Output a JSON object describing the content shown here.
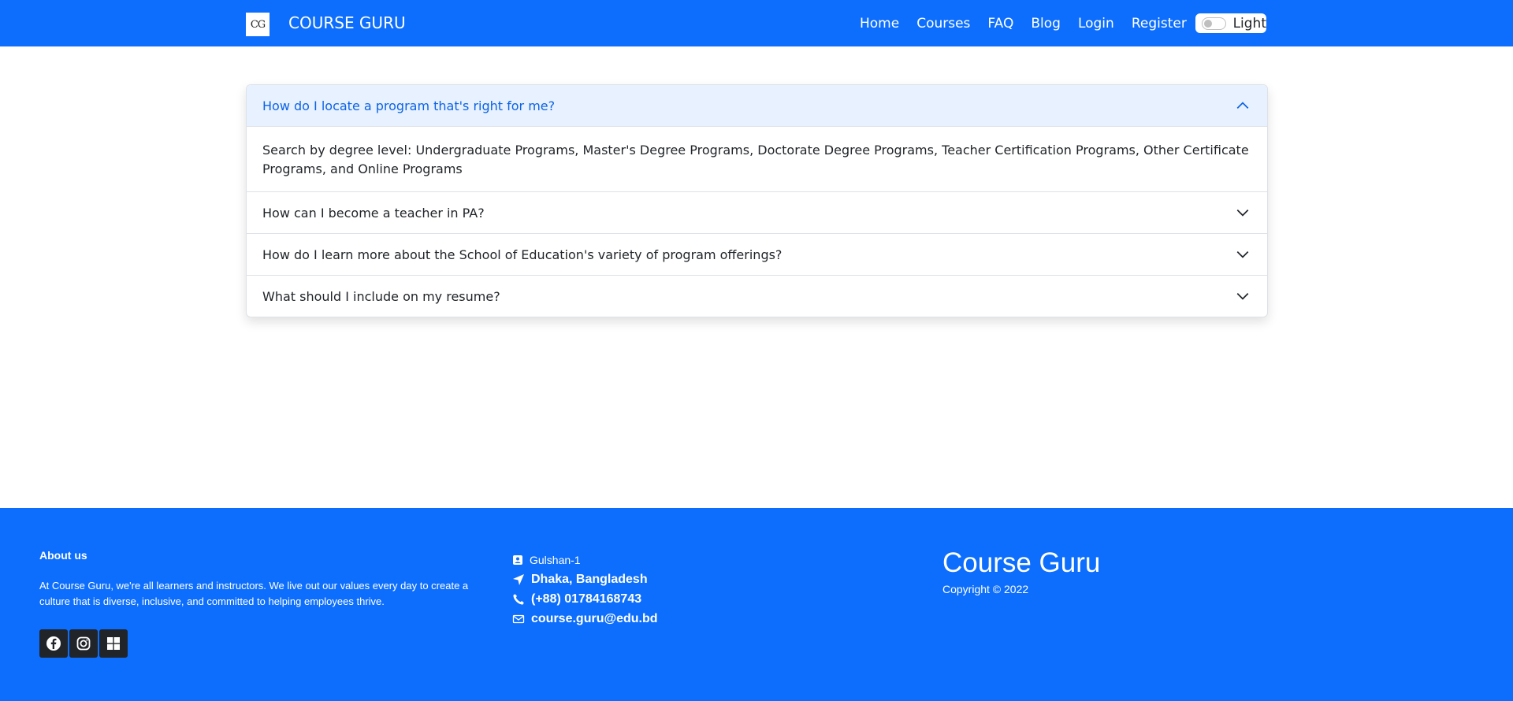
{
  "navbar": {
    "logo_text": "CG",
    "brand": "COURSE GURU",
    "links": [
      "Home",
      "Courses",
      "FAQ",
      "Blog",
      "Login",
      "Register"
    ],
    "theme_label": "Light",
    "theme_toggle_on": false
  },
  "faq": [
    {
      "question": "How do I locate a program that's right for me?",
      "answer": "Search by degree level: Undergraduate Programs, Master's Degree Programs, Doctorate Degree Programs, Teacher Certification Programs, Other Certificate Programs, and Online Programs",
      "expanded": true
    },
    {
      "question": "How can I become a teacher in PA?",
      "expanded": false
    },
    {
      "question": "How do I learn more about the School of Education's variety of program offerings?",
      "expanded": false
    },
    {
      "question": "What should I include on my resume?",
      "expanded": false
    }
  ],
  "footer": {
    "about_title": "About us",
    "about_text": "At Course Guru, we're all learners and instructors. We live out our values every day to create a culture that is diverse, inclusive, and committed to helping employees thrive.",
    "socials": [
      "facebook-icon",
      "instagram-icon",
      "windows-icon"
    ],
    "address_line1": "Gulshan-1",
    "address_line2": "Dhaka, Bangladesh",
    "phone": "(+88) 01784168743",
    "email": "course.guru@edu.bd",
    "brand": "Course Guru",
    "copyright": "Copyright © 2022"
  },
  "colors": {
    "primary": "#0d6efd",
    "accordion_open_bg": "#e7f1ff",
    "accordion_open_text": "#0c63e4",
    "social_bg": "#212529"
  }
}
